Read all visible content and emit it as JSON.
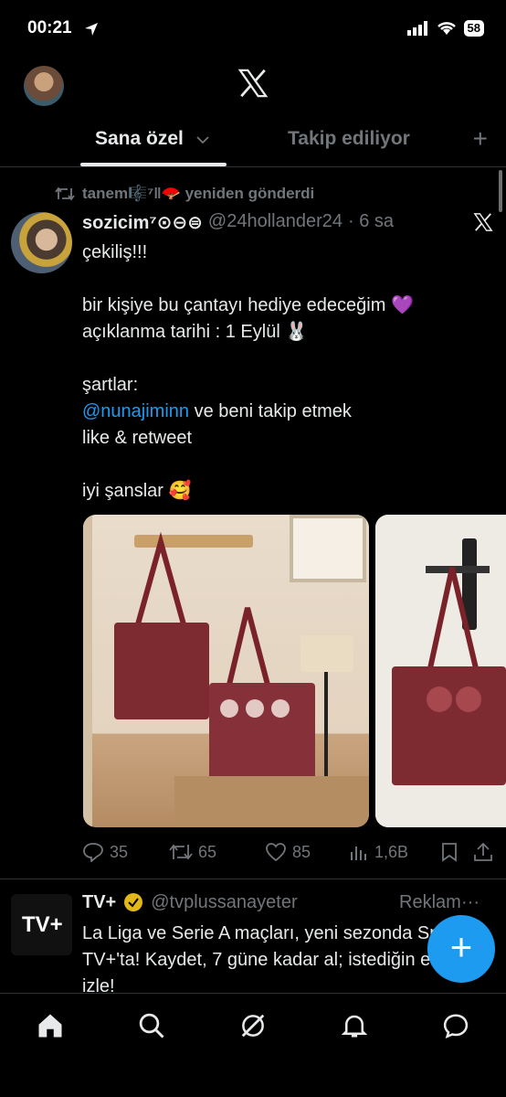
{
  "status_bar": {
    "time": "00:21",
    "battery": "58"
  },
  "tabs": [
    {
      "label": "Sana özel",
      "active": true
    },
    {
      "label": "Takip ediliyor",
      "active": false
    }
  ],
  "tweet": {
    "retweeted_by": "tanem🎼⁷‖🪭 yeniden gönderdi",
    "name": "sozicim⁷⊙⊖⊜",
    "handle": "@24hollander24",
    "time": "· 6 sa",
    "body_line1": "çekiliş!!!",
    "body_line2": "bir kişiye bu çantayı hediye edeceğim 💜",
    "body_line3": "açıklanma tarihi : 1 Eylül 🐰",
    "body_line4": "şartlar:",
    "mention": "@nunajiminn",
    "body_line5": " ve beni takip etmek",
    "body_line6": "like & retweet",
    "body_line7": "iyi şanslar 🥰",
    "replies": "35",
    "retweets": "65",
    "likes": "85",
    "views": "1,6B"
  },
  "ad": {
    "logo_text": "TV+",
    "name": "TV+",
    "handle": "@tvplussanayeter",
    "label": "Reklam",
    "more": "···",
    "body": "La Liga ve Serie A maçları, yeni sezonda Sport ile TV+'ta! Kaydet, 7 güne kadar al; istediğin ekranda izle!"
  },
  "fab": {
    "label": "+"
  },
  "colors": {
    "accent": "#1d9bf0",
    "muted": "#71767b",
    "text": "#e7e9ea",
    "background": "#000000"
  }
}
